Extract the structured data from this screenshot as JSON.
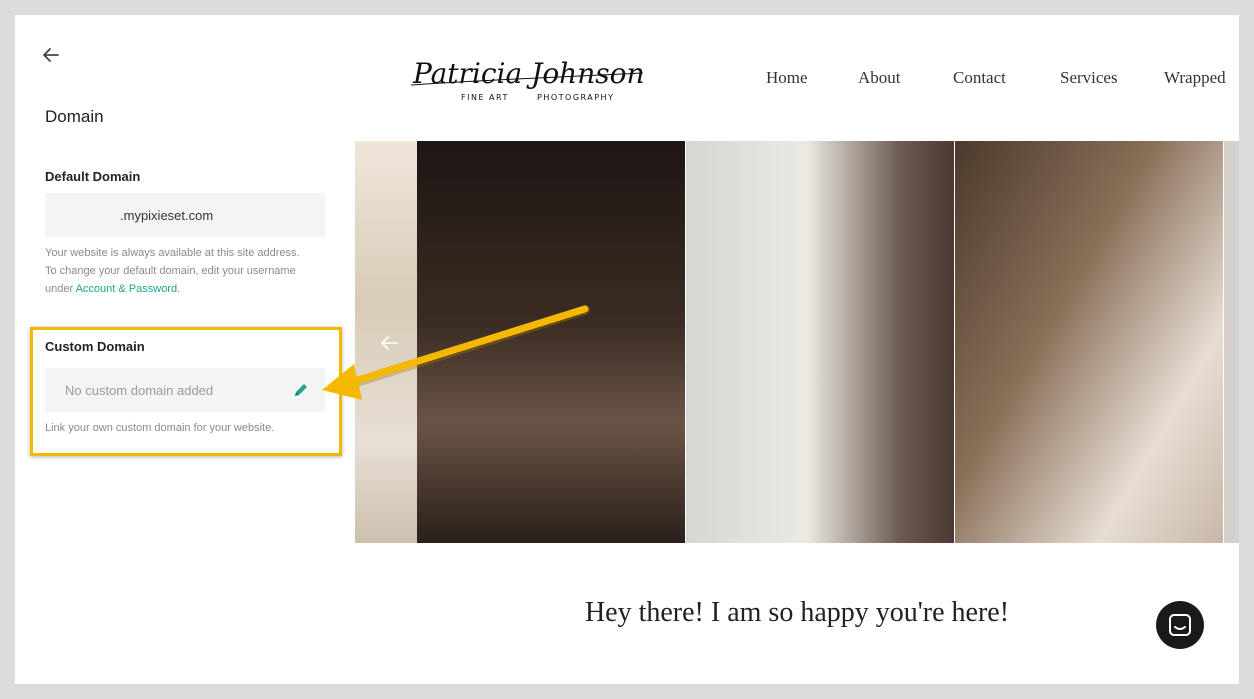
{
  "sidebar": {
    "title": "Domain",
    "default_domain": {
      "label": "Default Domain",
      "value": ".mypixieset.com",
      "help_line1": "Your website is always available at this site address.",
      "help_line2": "To change your default domain, edit your username",
      "help_pre_link": "under ",
      "help_link": "Account & Password",
      "help_post_link": "."
    },
    "custom_domain": {
      "label": "Custom Domain",
      "value": "No custom domain added",
      "help": "Link your own custom domain for your website."
    }
  },
  "site": {
    "logo_script": "Patricia Johnson",
    "logo_left": "FINE ART",
    "logo_right": "PHOTOGRAPHY",
    "nav": [
      "Home",
      "About",
      "Contact",
      "Services",
      "Wrapped"
    ],
    "welcome": "Hey there! I am so happy you're here!"
  },
  "colors": {
    "highlight": "#f5b800",
    "accent": "#1aa68a"
  }
}
